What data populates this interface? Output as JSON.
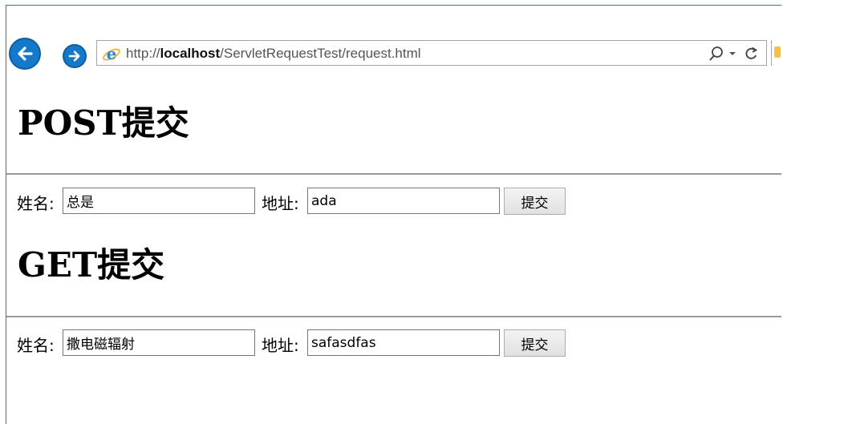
{
  "browser": {
    "url_prefix": "http://",
    "url_host": "localhost",
    "url_path": "/ServletRequestTest/request.html",
    "icons": [
      "back-arrow-icon",
      "forward-arrow-icon",
      "ie-logo-icon",
      "search-icon",
      "chevron-down-icon",
      "refresh-icon"
    ]
  },
  "post_form": {
    "heading": "POST提交",
    "name_label": "姓名:",
    "name_value": "总是",
    "address_label": "地址:",
    "address_value": "ada",
    "submit_label": "提交"
  },
  "get_form": {
    "heading": "GET提交",
    "name_label": "姓名:",
    "name_value": "撒电磁辐射",
    "address_label": "地址:",
    "address_value": "safasdfas",
    "submit_label": "提交"
  }
}
